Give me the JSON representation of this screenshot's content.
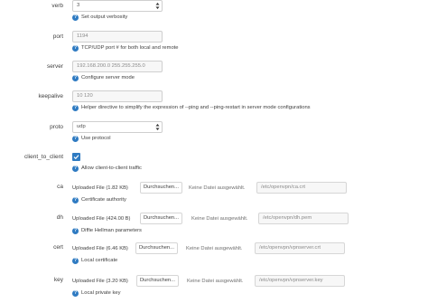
{
  "verb": {
    "label": "verb",
    "value": "3",
    "help": "Set output verbosity"
  },
  "port": {
    "label": "port",
    "value": "1194",
    "help": "TCP/UDP port # for both local and remote"
  },
  "server": {
    "label": "server",
    "value": "192.168.200.0 255.255.255.0",
    "help": "Configure server mode"
  },
  "keepalive": {
    "label": "keepalive",
    "value": "10 120",
    "help": "Helper directive to simplify the expression of --ping and --ping-restart in server mode configurations"
  },
  "proto": {
    "label": "proto",
    "value": "udp",
    "help": "Use protocol"
  },
  "client_to_client": {
    "label": "client_to_client",
    "checked": true,
    "help": "Allow client-to-client traffic"
  },
  "files": [
    {
      "label": "ca",
      "uploaded": "Uploaded File (1.82 KB)",
      "browse": "Durchsuchen...",
      "nofile": "Keine Datei ausgewählt.",
      "path": "/etc/openvpn/ca.crt",
      "help": "Certificate authority"
    },
    {
      "label": "dh",
      "uploaded": "Uploaded File (424.00 B)",
      "browse": "Durchsuchen...",
      "nofile": "Keine Datei ausgewählt.",
      "path": "/etc/openvpn/dh.pem",
      "help": "Diffie Hellman parameters"
    },
    {
      "label": "cert",
      "uploaded": "Uploaded File (6.46 KB)",
      "browse": "Durchsuchen...",
      "nofile": "Keine Datei ausgewählt.",
      "path": "/etc/openvpn/vpnserver.crt",
      "help": "Local certificate"
    },
    {
      "label": "key",
      "uploaded": "Uploaded File (3.20 KB)",
      "browse": "Durchsuchen...",
      "nofile": "Keine Datei ausgewählt.",
      "path": "/etc/openvpn/vpnserver.key",
      "help": "Local private key"
    }
  ],
  "colors": {
    "accent": "#2f7bc2",
    "field_bg": "#f7f7f7",
    "border": "#cfcfcf"
  },
  "icons": {
    "help": "help-circle-icon",
    "select": "select-arrows-icon",
    "check": "checkmark-icon"
  }
}
